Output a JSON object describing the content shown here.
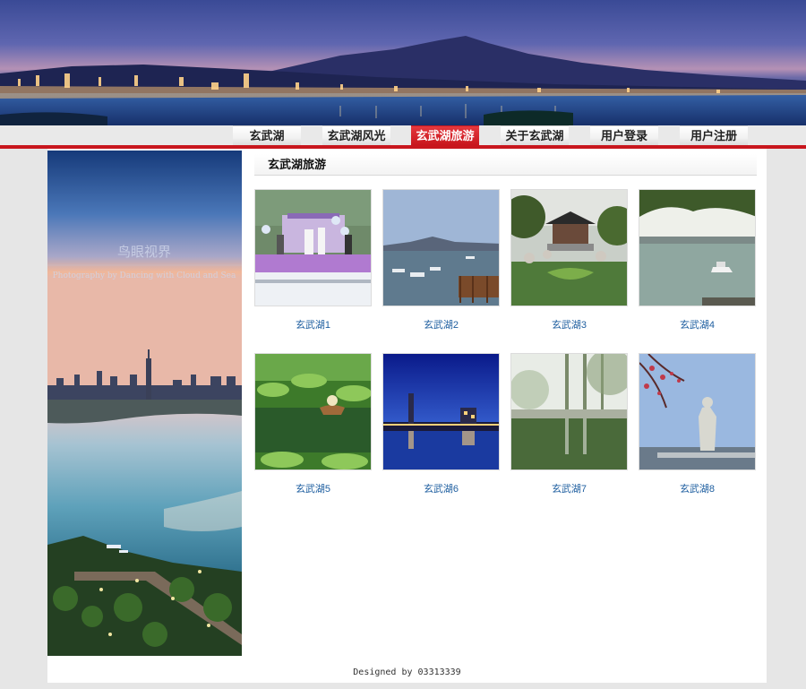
{
  "nav": [
    {
      "label": "玄武湖",
      "active": false
    },
    {
      "label": "玄武湖风光",
      "active": false
    },
    {
      "label": "玄武湖旅游",
      "active": true
    },
    {
      "label": "关于玄武湖",
      "active": false
    },
    {
      "label": "用户登录",
      "active": false
    },
    {
      "label": "用户注册",
      "active": false
    }
  ],
  "sidebar": {
    "watermark_cn": "鸟眼视界",
    "watermark_en": "Photography by Dancing with Cloud and Sea"
  },
  "content": {
    "title": "玄武湖旅游",
    "gallery": [
      {
        "caption": "玄武湖1",
        "scene": "wedding-boat"
      },
      {
        "caption": "玄武湖2",
        "scene": "lake-pier"
      },
      {
        "caption": "玄武湖3",
        "scene": "pavilion-pond"
      },
      {
        "caption": "玄武湖4",
        "scene": "lake-boat"
      },
      {
        "caption": "玄武湖5",
        "scene": "lotus-boat"
      },
      {
        "caption": "玄武湖6",
        "scene": "night-skyline"
      },
      {
        "caption": "玄武湖7",
        "scene": "tree-pond"
      },
      {
        "caption": "玄武湖8",
        "scene": "statue-blossom"
      }
    ]
  },
  "footer": {
    "text": "Designed by 03313339"
  },
  "colors": {
    "accent": "#c8161d",
    "link": "#1f5fa0",
    "background": "#e6e6e6"
  }
}
